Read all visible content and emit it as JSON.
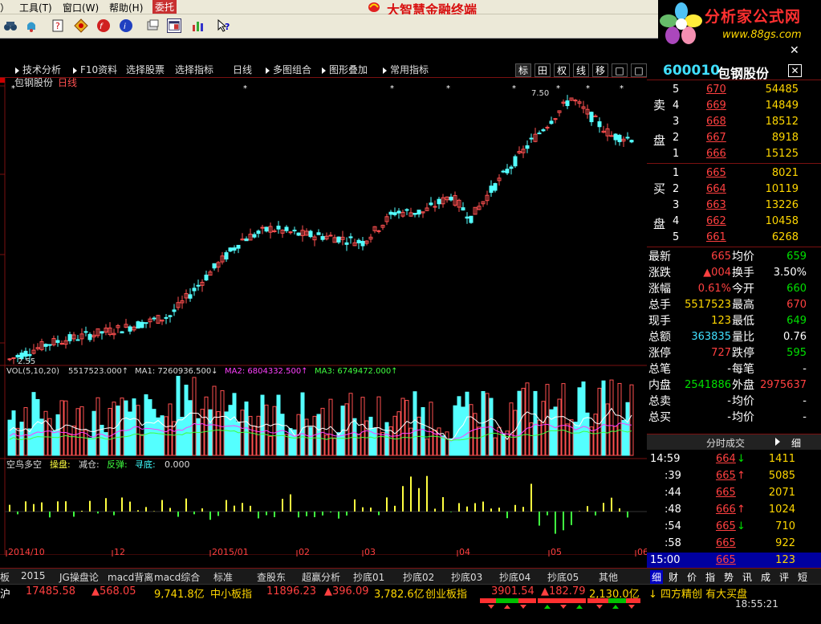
{
  "menu": {
    "items": [
      "工具(T)",
      "窗口(W)",
      "帮助(H)",
      "委托"
    ]
  },
  "app_title": "大智慧金融终端",
  "watermark": {
    "cn": "分析家公式网",
    "url": "www.88gs.com"
  },
  "tabs": [
    "技术分析",
    "F10资料",
    "选择股票",
    "选择指标",
    "日线",
    "多图组合",
    "图形叠加",
    "常用指标"
  ],
  "right_tabs": [
    "标",
    "田",
    "权",
    "线",
    "移",
    "□",
    "□"
  ],
  "chart": {
    "stock_label": "包钢股份",
    "period_label": "日线",
    "low_label": "2.55",
    "high_label": "7.50",
    "vol_label": "VOL(5,10,20)",
    "vol_value": "5517523.000↑",
    "ma1": "MA1: 7260936.500↓",
    "ma2": "MA2: 6804332.500↑",
    "ma3": "MA3: 6749472.000↑",
    "ind_name": "空鸟多空",
    "ind_items": [
      "操盘:",
      "减仓:",
      "反弹:",
      "寻底:"
    ],
    "ind_value": "0.000",
    "dates": [
      "2014/10",
      "12",
      "2015/01",
      "02",
      "03",
      "04",
      "05",
      "06"
    ]
  },
  "quote": {
    "code": "600010",
    "name": "包钢股份",
    "sell_label": [
      "卖",
      "盘"
    ],
    "buy_label": [
      "买",
      "盘"
    ],
    "sell": [
      {
        "n": "5",
        "p": "670",
        "v": "54485"
      },
      {
        "n": "4",
        "p": "669",
        "v": "14849"
      },
      {
        "n": "3",
        "p": "668",
        "v": "18512"
      },
      {
        "n": "2",
        "p": "667",
        "v": "8918"
      },
      {
        "n": "1",
        "p": "666",
        "v": "15125"
      }
    ],
    "buy": [
      {
        "n": "1",
        "p": "665",
        "v": "8021"
      },
      {
        "n": "2",
        "p": "664",
        "v": "10119"
      },
      {
        "n": "3",
        "p": "663",
        "v": "13226"
      },
      {
        "n": "4",
        "p": "662",
        "v": "10458"
      },
      {
        "n": "5",
        "p": "661",
        "v": "6268"
      }
    ],
    "stats": [
      {
        "l1": "最新",
        "v1": "665",
        "l2": "均价",
        "v2": "659"
      },
      {
        "l1": "涨跌",
        "v1": "▲004",
        "l2": "换手",
        "v2": "3.50%"
      },
      {
        "l1": "涨幅",
        "v1": "0.61%",
        "l2": "今开",
        "v2": "660"
      },
      {
        "l1": "总手",
        "v1": "5517523",
        "l2": "最高",
        "v2": "670"
      },
      {
        "l1": "现手",
        "v1": "123",
        "l2": "最低",
        "v2": "649"
      },
      {
        "l1": "总额",
        "v1": "363835",
        "l2": "量比",
        "v2": "0.76"
      },
      {
        "l1": "涨停",
        "v1": "727",
        "l2": "跌停",
        "v2": "595"
      },
      {
        "l1": "总笔",
        "v1": "-",
        "l2": "每笔",
        "v2": "-"
      },
      {
        "l1": "内盘",
        "v1": "2541886",
        "l2": "外盘",
        "v2": "2975637"
      },
      {
        "l1": "总卖",
        "v1": "-",
        "l2": "均价",
        "v2": "-"
      },
      {
        "l1": "总买",
        "v1": "-",
        "l2": "均价",
        "v2": "-"
      }
    ],
    "ticks_header": "分时成交",
    "ticks_btn": "细",
    "ticks": [
      {
        "t": "14:59",
        "p": "664",
        "a": "↓",
        "v": "1411"
      },
      {
        "t": ":39",
        "p": "665",
        "a": "↑",
        "v": "5085"
      },
      {
        "t": ":44",
        "p": "665",
        "a": "",
        "v": "2071"
      },
      {
        "t": ":48",
        "p": "666",
        "a": "↑",
        "v": "1024"
      },
      {
        "t": ":54",
        "p": "665",
        "a": "↓",
        "v": "710"
      },
      {
        "t": ":58",
        "p": "665",
        "a": "",
        "v": "922"
      },
      {
        "t": "15:00",
        "p": "665",
        "a": "",
        "v": "123"
      }
    ],
    "mini_tabs": [
      "细",
      "财",
      "价",
      "指",
      "势",
      "讯",
      "成",
      "评",
      "短"
    ]
  },
  "bottom_tabs": [
    "板",
    "2015",
    "JG操盘论",
    "macd背离",
    "macd综合",
    "标准",
    "查股东",
    "超赢分析",
    "抄底01",
    "抄底02",
    "抄底03",
    "抄底04",
    "抄底05",
    "其他"
  ],
  "status": {
    "idx1": "17485.58",
    "chg1": "▲568.05",
    "amt1": "9,741.8亿",
    "name2": "中小板指",
    "idx2": "11896.23",
    "chg2": "▲396.09",
    "amt2": "3,782.6亿",
    "name3": "创业板指",
    "idx3": "3901.54",
    "chg3": "▲182.79",
    "amt3": "2,130.0亿",
    "news": "↓ 四方精创 有大买盘",
    "time": "18:55:21",
    "left_char": "沪"
  }
}
